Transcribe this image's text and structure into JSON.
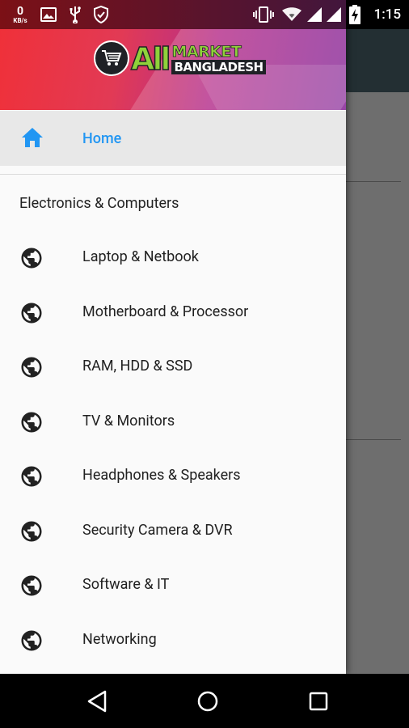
{
  "status_bar": {
    "net_speed_value": "0",
    "net_speed_unit": "KB/s",
    "time": "1:15",
    "icons": [
      "image-icon",
      "usb-icon",
      "shield-icon",
      "vibrate-icon",
      "wifi-icon",
      "signal-icon",
      "signal-icon",
      "battery-charging-icon"
    ]
  },
  "drawer": {
    "header": {
      "logo_left": "All",
      "logo_top": "MARKET",
      "logo_bottom": "BANGLADESH"
    },
    "home": {
      "label": "Home",
      "icon": "home-icon",
      "color": "#2196f3"
    },
    "section_title": "Electronics & Computers",
    "items": [
      {
        "label": "Laptop & Netbook",
        "icon": "globe-icon"
      },
      {
        "label": "Motherboard & Processor",
        "icon": "globe-icon"
      },
      {
        "label": "RAM, HDD & SSD",
        "icon": "globe-icon"
      },
      {
        "label": "TV & Monitors",
        "icon": "globe-icon"
      },
      {
        "label": "Headphones & Speakers",
        "icon": "globe-icon"
      },
      {
        "label": "Security Camera & DVR",
        "icon": "globe-icon"
      },
      {
        "label": "Software & IT",
        "icon": "globe-icon"
      },
      {
        "label": "Networking",
        "icon": "globe-icon"
      }
    ]
  },
  "nav_bar": {
    "buttons": [
      "back-icon",
      "home-circle-icon",
      "recents-icon"
    ]
  }
}
